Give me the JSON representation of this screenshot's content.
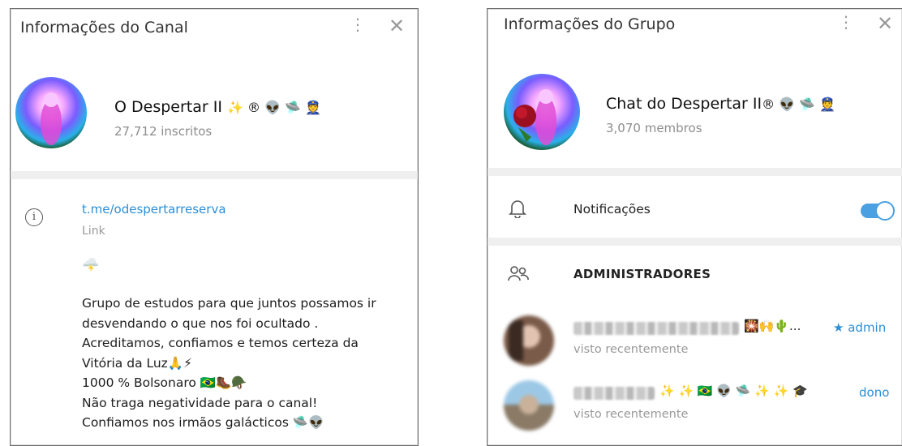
{
  "channel": {
    "header_title": "Informações do Canal",
    "name": "O Despertar II",
    "name_emojis": "✨ ® 👽 🛸 👮",
    "subscribers": "27,712 inscritos",
    "link": "t.me/odespertarreserva",
    "link_label": "Link",
    "weather_emoji": "🌩️",
    "description_lines": [
      "Grupo de estudos para que juntos possamos ir",
      "desvendando o que nos foi ocultado .",
      "Acreditamos,  confiamos e temos certeza  da",
      "Vitória da Luz🙏⚡",
      "1000 % Bolsonaro  🇧🇷🥾🪖",
      "Não traga negatividade para o canal!",
      "Confiamos  nos irmãos galácticos 🛸👽"
    ]
  },
  "group": {
    "header_title": "Informações do Grupo",
    "name": "Chat do Despertar II",
    "name_emojis": "® 👽 🛸 👮",
    "members": "3,070 membros",
    "notifications_label": "Notificações",
    "notifications_on": true,
    "admins_label": "ADMINISTRADORES",
    "admins": [
      {
        "emojis": "🎇🙌🌵...",
        "role_star": "★",
        "role": "admin",
        "status": "visto recentemente"
      },
      {
        "emojis": "✨ ✨ 🇧🇷 👽 🛸 ✨ ✨ 🎓",
        "role_star": "",
        "role": "dono",
        "status": "visto recentemente"
      }
    ]
  },
  "icons": {
    "kebab": "⋮",
    "close": "✕",
    "info": "i",
    "bell": "🔔",
    "people": "👥"
  },
  "colors": {
    "link": "#2a8fd6",
    "toggle": "#4aa0e0",
    "muted": "#8d8d8d"
  }
}
